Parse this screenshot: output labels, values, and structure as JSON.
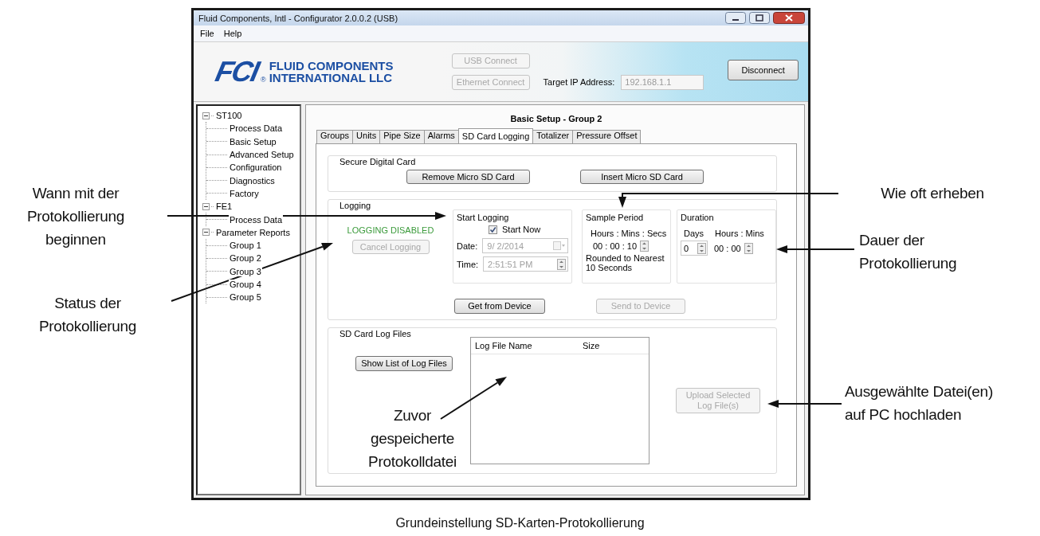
{
  "window": {
    "title": "Fluid Components, Intl - Configurator 2.0.0.2 (USB)"
  },
  "menu": [
    "File",
    "Help"
  ],
  "header": {
    "logo_mark": "FCI",
    "logo_registered": "®",
    "logo_lines": [
      "FLUID COMPONENTS",
      "INTERNATIONAL LLC"
    ],
    "usb_button": {
      "label": "USB Connect",
      "disabled": true
    },
    "ethernet_button": {
      "label": "Ethernet Connect",
      "disabled": true
    },
    "ip_label": "Target IP Address:",
    "ip_value": "192.168.1.1",
    "disconnect_button": {
      "label": "Disconnect",
      "disabled": false
    }
  },
  "tree": [
    {
      "label": "ST100",
      "expanded": true,
      "children": [
        {
          "label": "Process Data"
        },
        {
          "label": "Basic Setup"
        },
        {
          "label": "Advanced Setup"
        },
        {
          "label": "Configuration"
        },
        {
          "label": "Diagnostics"
        },
        {
          "label": "Factory"
        }
      ]
    },
    {
      "label": "FE1",
      "expanded": true,
      "children": [
        {
          "label": "Process Data"
        }
      ]
    },
    {
      "label": "Parameter Reports",
      "expanded": true,
      "children": [
        {
          "label": "Group 1"
        },
        {
          "label": "Group 2"
        },
        {
          "label": "Group 3"
        },
        {
          "label": "Group 4"
        },
        {
          "label": "Group 5"
        }
      ]
    }
  ],
  "panel": {
    "title": "Basic Setup - Group 2",
    "tabs": [
      {
        "label": "Groups",
        "selected": false
      },
      {
        "label": "Units",
        "selected": false
      },
      {
        "label": "Pipe Size",
        "selected": false
      },
      {
        "label": "Alarms",
        "selected": false
      },
      {
        "label": "SD Card Logging",
        "selected": true
      },
      {
        "label": "Totalizer",
        "selected": false
      },
      {
        "label": "Pressure Offset",
        "selected": false
      }
    ],
    "secure_card": {
      "title": "Secure Digital Card",
      "remove_button": {
        "label": "Remove Micro SD Card",
        "disabled": false
      },
      "insert_button": {
        "label": "Insert Micro SD Card",
        "disabled": false
      }
    },
    "logging": {
      "title": "Logging",
      "status": "LOGGING DISABLED",
      "cancel_button": {
        "label": "Cancel Logging",
        "disabled": true
      },
      "start": {
        "title": "Start Logging",
        "start_now": {
          "label": "Start Now",
          "checked": true
        },
        "date_label": "Date:",
        "date_value": "9/ 2/2014",
        "time_label": "Time:",
        "time_value": "2:51:51 PM",
        "disabled": true
      },
      "sample": {
        "title": "Sample Period",
        "units": "Hours : Mins : Secs",
        "value": "00 : 00 : 10",
        "note": "Rounded to Nearest 10 Seconds"
      },
      "duration": {
        "title": "Duration",
        "days_label": "Days",
        "days_value": "0",
        "hm_label": "Hours : Mins",
        "hm_value": "00 : 00"
      },
      "get_button": {
        "label": "Get from Device",
        "disabled": false
      },
      "send_button": {
        "label": "Send to Device",
        "disabled": true
      }
    },
    "log_files": {
      "title": "SD Card Log Files",
      "show_button": {
        "label": "Show List of Log Files",
        "disabled": false
      },
      "columns": [
        "Log File Name",
        "Size"
      ],
      "upload_button": {
        "label": "Upload Selected Log File(s)",
        "disabled": true
      }
    }
  },
  "callouts": [
    {
      "text": "Wann mit der\nProtokollierung\nbeginnen"
    },
    {
      "text": "Status der\nProtokollierung"
    },
    {
      "text": "Wie oft erheben"
    },
    {
      "text": "Dauer der\nProtokollierung"
    },
    {
      "text": "Ausgewählte Datei(en)\nauf PC hochladen"
    },
    {
      "text": "Zuvor\ngespeicherte\nProtokolldatei"
    }
  ],
  "caption": "Grundeinstellung SD-Karten-Protokollierung"
}
